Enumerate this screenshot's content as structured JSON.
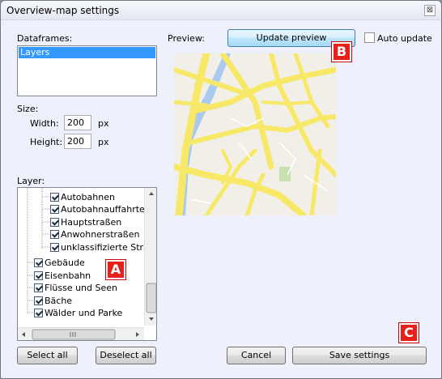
{
  "window": {
    "title": "Overview-map settings",
    "close_glyph": "⊠"
  },
  "dataframes": {
    "label": "Dataframes:",
    "items": [
      "Layers"
    ],
    "selected": "Layers"
  },
  "size": {
    "label": "Size:",
    "width_label": "Width:",
    "width_value": "200",
    "width_unit": "px",
    "height_label": "Height:",
    "height_value": "200",
    "height_unit": "px"
  },
  "preview": {
    "label": "Preview:",
    "update_button": "Update preview",
    "auto_update_label": "Auto update",
    "auto_update_checked": false
  },
  "layer": {
    "label": "Layer:",
    "items": [
      {
        "label": "Autobahnen",
        "checked": true
      },
      {
        "label": "Autobahnauffahrten",
        "checked": true
      },
      {
        "label": "Hauptstraßen",
        "checked": true
      },
      {
        "label": "Anwohnerstraßen",
        "checked": true
      },
      {
        "label": "unklassifizierte Straß",
        "checked": true
      },
      {
        "label": "Gebäude",
        "checked": true
      },
      {
        "label": "Eisenbahn",
        "checked": true
      },
      {
        "label": "Flüsse und Seen",
        "checked": true
      },
      {
        "label": "Bäche",
        "checked": true
      },
      {
        "label": "Wälder und Parke",
        "checked": true
      }
    ]
  },
  "buttons": {
    "select_all": "Select all",
    "deselect_all": "Deselect all",
    "cancel": "Cancel",
    "save": "Save settings"
  },
  "callouts": {
    "a": "A",
    "b": "B",
    "c": "C"
  },
  "colors": {
    "road": "#f7e967",
    "river": "#a9c9ee",
    "park": "#c8dfb0",
    "badge": "#e8201c"
  }
}
